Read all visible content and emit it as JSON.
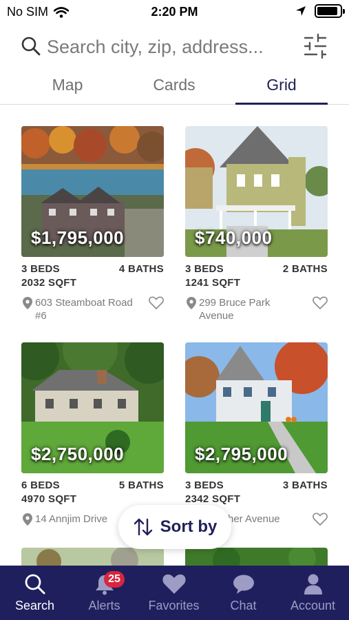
{
  "status_bar": {
    "carrier": "No SIM",
    "time": "2:20 PM",
    "battery_level": 0.9
  },
  "search": {
    "placeholder": "Search city, zip, address...",
    "value": ""
  },
  "tabs": [
    {
      "label": "Map",
      "active": false
    },
    {
      "label": "Cards",
      "active": false
    },
    {
      "label": "Grid",
      "active": true
    }
  ],
  "listings": [
    {
      "price": "$1,795,000",
      "beds": "3 BEDS",
      "baths": "4 BATHS",
      "sqft": "2032 SQFT",
      "address": "603 Steamboat Road #6"
    },
    {
      "price": "$740,000",
      "beds": "3 BEDS",
      "baths": "2 BATHS",
      "sqft": "1241 SQFT",
      "address": "299 Bruce Park Avenue"
    },
    {
      "price": "$2,750,000",
      "beds": "6 BEDS",
      "baths": "5 BATHS",
      "sqft": "4970 SQFT",
      "address": "14 Annjim Drive"
    },
    {
      "price": "$2,795,000",
      "beds": "3 BEDS",
      "baths": "3 BATHS",
      "sqft": "2342 SQFT",
      "address": "her Avenue"
    }
  ],
  "sort": {
    "label": "Sort by",
    "icon": "sort-arrows-icon"
  },
  "bottom_nav": [
    {
      "label": "Search",
      "icon": "search-icon",
      "active": true
    },
    {
      "label": "Alerts",
      "icon": "bell-icon",
      "badge": "25",
      "active": false
    },
    {
      "label": "Favorites",
      "icon": "heart-icon",
      "active": false
    },
    {
      "label": "Chat",
      "icon": "chat-icon",
      "active": false
    },
    {
      "label": "Account",
      "icon": "account-icon",
      "active": false
    }
  ],
  "colors": {
    "brand_navy": "#1f1f5e",
    "accent_text": "#20205a",
    "badge_red": "#d7263d"
  }
}
